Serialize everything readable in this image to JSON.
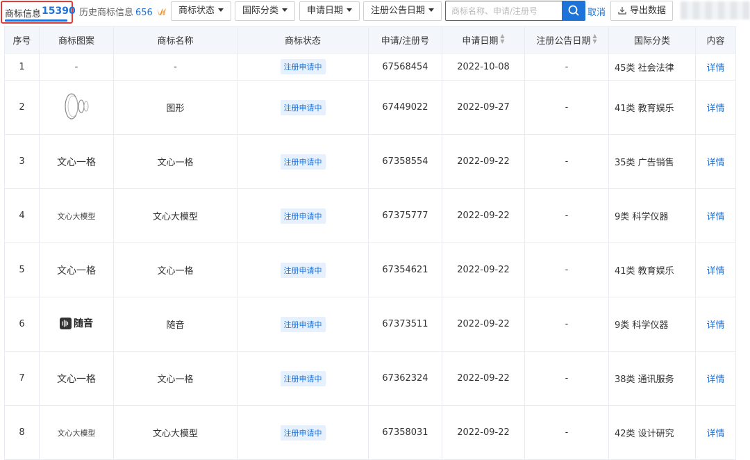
{
  "tabs": {
    "active": {
      "label": "商标信息",
      "count": "15390"
    },
    "history": {
      "label": "历史商标信息",
      "count": "656"
    }
  },
  "filters": {
    "status": "商标状态",
    "intl_class": "国际分类",
    "apply_date": "申请日期",
    "announce_date": "注册公告日期"
  },
  "search": {
    "placeholder": "商标名称、申请/注册号"
  },
  "actions": {
    "cancel": "取消",
    "export": "导出数据"
  },
  "table": {
    "headers": {
      "index": "序号",
      "image": "商标图案",
      "name": "商标名称",
      "status": "商标状态",
      "reg_no": "申请/注册号",
      "apply_date": "申请日期",
      "announce_date": "注册公告日期",
      "intl_class": "国际分类",
      "content": "内容"
    },
    "rows": [
      {
        "index": "1",
        "image": "-",
        "name": "-",
        "status": "注册申请中",
        "reg_no": "67568454",
        "apply_date": "2022-10-08",
        "announce_date": "-",
        "intl_class": "45类 社会法律",
        "content": "详情"
      },
      {
        "index": "2",
        "image": "",
        "name": "图形",
        "status": "注册申请中",
        "reg_no": "67449022",
        "apply_date": "2022-09-27",
        "announce_date": "-",
        "intl_class": "41类 教育娱乐",
        "content": "详情"
      },
      {
        "index": "3",
        "image": "文心一格",
        "name": "文心一格",
        "status": "注册申请中",
        "reg_no": "67358554",
        "apply_date": "2022-09-22",
        "announce_date": "-",
        "intl_class": "35类 广告销售",
        "content": "详情"
      },
      {
        "index": "4",
        "image": "文心大模型",
        "name": "文心大模型",
        "status": "注册申请中",
        "reg_no": "67375777",
        "apply_date": "2022-09-22",
        "announce_date": "-",
        "intl_class": "9类 科学仪器",
        "content": "详情"
      },
      {
        "index": "5",
        "image": "文心一格",
        "name": "文心一格",
        "status": "注册申请中",
        "reg_no": "67354621",
        "apply_date": "2022-09-22",
        "announce_date": "-",
        "intl_class": "41类 教育娱乐",
        "content": "详情"
      },
      {
        "index": "6",
        "image": "随音",
        "name": "随音",
        "status": "注册申请中",
        "reg_no": "67373511",
        "apply_date": "2022-09-22",
        "announce_date": "-",
        "intl_class": "9类 科学仪器",
        "content": "详情"
      },
      {
        "index": "7",
        "image": "文心一格",
        "name": "文心一格",
        "status": "注册申请中",
        "reg_no": "67362324",
        "apply_date": "2022-09-22",
        "announce_date": "-",
        "intl_class": "38类 通讯服务",
        "content": "详情"
      },
      {
        "index": "8",
        "image": "文心大模型",
        "name": "文心大模型",
        "status": "注册申请中",
        "reg_no": "67358031",
        "apply_date": "2022-09-22",
        "announce_date": "-",
        "intl_class": "42类 设计研究",
        "content": "详情"
      }
    ]
  },
  "colors": {
    "accent": "#1e73d8",
    "highlight_border": "#e53935",
    "vip": "#f08a24"
  },
  "icons": {
    "search": "search-icon",
    "export": "download-icon",
    "vip": "vip-icon",
    "sort": "sort-icon"
  }
}
